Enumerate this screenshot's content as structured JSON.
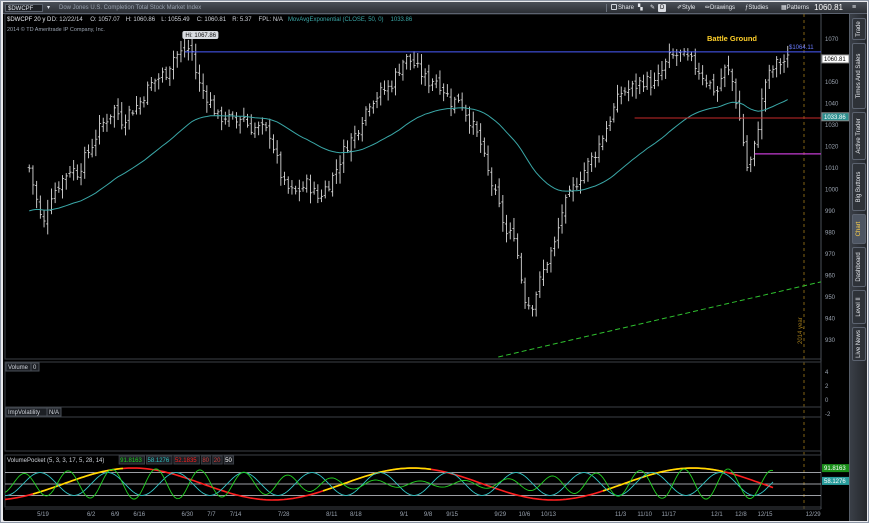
{
  "toolbar": {
    "symbol": "$DWCPF",
    "description": "Dow Jones U.S. Completion Total Stock Market Index",
    "share": "Share",
    "style": "Style",
    "drawings": "Drawings",
    "studies": "Studies",
    "patterns": "Patterns",
    "last": "1060.81",
    "d_button": "D"
  },
  "sidebar": {
    "tabs": [
      "Trade",
      "Times And Sales",
      "Active Trader",
      "Big Buttons",
      "Chart",
      "Dashboard",
      "Level II",
      "Live News"
    ],
    "active": "Chart"
  },
  "colors": {
    "background": "#000000",
    "bar": "#d9d9d9",
    "ma": "#3aa7a7",
    "resistance": "#4a5cff",
    "support_red": "#c62a2a",
    "magenta": "#c23bd1",
    "trendline": "#2fc12f",
    "osc_red": "#ff2020",
    "osc_yellow": "#ffe000",
    "osc_green": "#22d022",
    "osc_cyan": "#31c6c6"
  },
  "chart_data": [
    {
      "type": "ohlc",
      "panel": "price",
      "header": [
        "$DWCPF 20 y D",
        "D: 12/22/14",
        "O: 1057.07",
        "H: 1060.86",
        "L: 1055.49",
        "C: 1060.81",
        "R: 5.37",
        "FPL: N/A",
        "MovAvgExponential (CLOSE, 50, 0)",
        "1033.86"
      ],
      "copyright": "2014 © TD Ameritrade IP Company, Inc.",
      "ylim": [
        922,
        1078
      ],
      "yticks": [
        930,
        940,
        950,
        960,
        970,
        980,
        990,
        1000,
        1010,
        1020,
        1030,
        1040,
        1050,
        1060,
        1070
      ],
      "xlabels": [
        "5/19",
        "6/2",
        "6/9",
        "6/16",
        "6/30",
        "7/7",
        "7/14",
        "7/28",
        "8/11",
        "8/18",
        "9/1",
        "9/8",
        "9/15",
        "9/29",
        "10/6",
        "10/13",
        "11/3",
        "11/10",
        "11/17",
        "12/1",
        "12/8",
        "12/15",
        "12/29"
      ],
      "close_path": [
        [
          "5/15",
          1010
        ],
        [
          "5/19",
          982
        ],
        [
          "5/21",
          997
        ],
        [
          "5/23",
          1001
        ],
        [
          "5/27",
          1010
        ],
        [
          "5/29",
          1008
        ],
        [
          "6/2",
          1020
        ],
        [
          "6/4",
          1027
        ],
        [
          "6/6",
          1032
        ],
        [
          "6/9",
          1038
        ],
        [
          "6/11",
          1032
        ],
        [
          "6/13",
          1036
        ],
        [
          "6/16",
          1040
        ],
        [
          "6/18",
          1046
        ],
        [
          "6/20",
          1050
        ],
        [
          "6/24",
          1055
        ],
        [
          "6/26",
          1062
        ],
        [
          "6/30",
          1065
        ],
        [
          "7/1",
          1067
        ],
        [
          "7/3",
          1050
        ],
        [
          "7/7",
          1040
        ],
        [
          "7/9",
          1033
        ],
        [
          "7/11",
          1034
        ],
        [
          "7/14",
          1031
        ],
        [
          "7/16",
          1035
        ],
        [
          "7/18",
          1029
        ],
        [
          "7/22",
          1028
        ],
        [
          "7/24",
          1026
        ],
        [
          "7/28",
          1002
        ],
        [
          "7/31",
          998
        ],
        [
          "8/4",
          1003
        ],
        [
          "8/7",
          996
        ],
        [
          "8/11",
          1005
        ],
        [
          "8/13",
          1012
        ],
        [
          "8/15",
          1020
        ],
        [
          "8/18",
          1026
        ],
        [
          "8/20",
          1034
        ],
        [
          "8/22",
          1041
        ],
        [
          "8/26",
          1046
        ],
        [
          "8/28",
          1048
        ],
        [
          "9/1",
          1061
        ],
        [
          "9/3",
          1060
        ],
        [
          "9/5",
          1056
        ],
        [
          "9/8",
          1050
        ],
        [
          "9/10",
          1052
        ],
        [
          "9/12",
          1048
        ],
        [
          "9/15",
          1040
        ],
        [
          "9/17",
          1043
        ],
        [
          "9/19",
          1036
        ],
        [
          "9/23",
          1023
        ],
        [
          "9/25",
          1010
        ],
        [
          "9/29",
          990
        ],
        [
          "10/1",
          978
        ],
        [
          "10/3",
          980
        ],
        [
          "10/6",
          950
        ],
        [
          "10/8",
          945
        ],
        [
          "10/10",
          955
        ],
        [
          "10/13",
          968
        ],
        [
          "10/15",
          975
        ],
        [
          "10/17",
          990
        ],
        [
          "10/21",
          1003
        ],
        [
          "10/23",
          1008
        ],
        [
          "10/27",
          1018
        ],
        [
          "11/3",
          1045
        ],
        [
          "11/6",
          1047
        ],
        [
          "11/10",
          1051
        ],
        [
          "11/13",
          1049
        ],
        [
          "11/17",
          1061
        ],
        [
          "11/20",
          1063
        ],
        [
          "11/24",
          1059
        ],
        [
          "12/1",
          1045
        ],
        [
          "12/3",
          1056
        ],
        [
          "12/5",
          1054
        ],
        [
          "12/8",
          1030
        ],
        [
          "12/10",
          1008
        ],
        [
          "12/12",
          1020
        ],
        [
          "12/15",
          1050
        ],
        [
          "12/18",
          1058
        ],
        [
          "12/22",
          1060.81
        ]
      ],
      "ema50_level": 1033.86,
      "annotations": {
        "high_label": "Hi: 1067.86",
        "line_label": "$1064.11",
        "text": "Battle Ground",
        "vertical_label": "2014 year",
        "last_price": "1060.81",
        "ema_price": "1033.86"
      },
      "levels": {
        "resistance": 1064.11,
        "support_red": 1033.3,
        "magenta": 1016.6
      },
      "trendline": {
        "from": [
          "9/29",
          922
        ],
        "to": [
          "12/29",
          957
        ]
      }
    },
    {
      "type": "bar",
      "panel": "volume",
      "title": "Volume",
      "value": "0",
      "yticks": [
        4,
        2,
        0,
        -2
      ]
    },
    {
      "type": "line",
      "panel": "implied_volatility",
      "title": "ImpVolatility",
      "value": "N/A"
    },
    {
      "type": "line",
      "panel": "volume_pocket",
      "title": "VolumePocket (5, 3, 3, 17, 5, 28, 14)",
      "values": [
        "91.8163",
        "58.1276",
        "52.1835",
        "80",
        "20",
        "50"
      ],
      "value_colors": [
        "#22d022",
        "#31c6c6",
        "#ff2020",
        "#d04040",
        "#d04040",
        "#ffffff"
      ],
      "last_labels": [
        "91.8163",
        "58.1276"
      ]
    }
  ]
}
